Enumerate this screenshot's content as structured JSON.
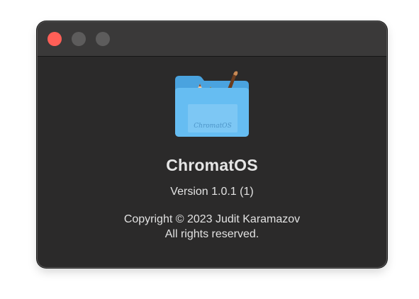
{
  "window": {
    "traffic_lights": {
      "close_color": "#ff5f57",
      "minimize_color": "#5d5c5c",
      "zoom_color": "#5d5c5c"
    }
  },
  "about": {
    "icon": "folder-with-pencils-and-brush-icon",
    "icon_label": "ChromatOS",
    "app_name": "ChromatOS",
    "version": "Version 1.0.1 (1)",
    "copyright_line1": "Copyright © 2023 Judit Karamazov",
    "copyright_line2": "All rights reserved."
  },
  "colors": {
    "window_bg": "#2b2a2a",
    "titlebar_bg": "#3a3939",
    "folder_blue": "#5ab4ee",
    "text": "#e2e2e2"
  }
}
